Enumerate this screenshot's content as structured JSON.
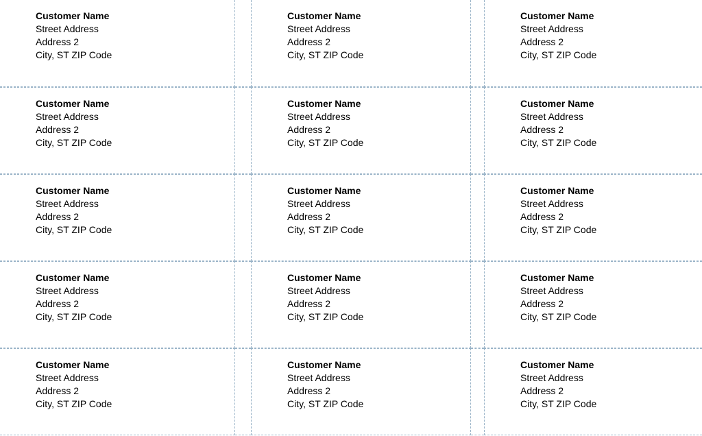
{
  "labels": [
    [
      {
        "name": "Customer Name",
        "street": "Street Address",
        "addr2": "Address 2",
        "csz": "City, ST  ZIP Code"
      },
      {
        "name": "Customer Name",
        "street": "Street Address",
        "addr2": "Address 2",
        "csz": "City, ST  ZIP Code"
      },
      {
        "name": "Customer Name",
        "street": "Street Address",
        "addr2": "Address 2",
        "csz": "City, ST  ZIP Code"
      }
    ],
    [
      {
        "name": "Customer Name",
        "street": "Street Address",
        "addr2": "Address 2",
        "csz": "City, ST  ZIP Code"
      },
      {
        "name": "Customer Name",
        "street": "Street Address",
        "addr2": "Address 2",
        "csz": "City, ST  ZIP Code"
      },
      {
        "name": "Customer Name",
        "street": "Street Address",
        "addr2": "Address 2",
        "csz": "City, ST  ZIP Code"
      }
    ],
    [
      {
        "name": "Customer Name",
        "street": "Street Address",
        "addr2": "Address 2",
        "csz": "City, ST  ZIP Code"
      },
      {
        "name": "Customer Name",
        "street": "Street Address",
        "addr2": "Address 2",
        "csz": "City, ST  ZIP Code"
      },
      {
        "name": "Customer Name",
        "street": "Street Address",
        "addr2": "Address 2",
        "csz": "City, ST  ZIP Code"
      }
    ],
    [
      {
        "name": "Customer Name",
        "street": "Street Address",
        "addr2": "Address 2",
        "csz": "City, ST  ZIP Code"
      },
      {
        "name": "Customer Name",
        "street": "Street Address",
        "addr2": "Address 2",
        "csz": "City, ST  ZIP Code"
      },
      {
        "name": "Customer Name",
        "street": "Street Address",
        "addr2": "Address 2",
        "csz": "City, ST  ZIP Code"
      }
    ],
    [
      {
        "name": "Customer Name",
        "street": "Street Address",
        "addr2": "Address 2",
        "csz": "City, ST  ZIP Code"
      },
      {
        "name": "Customer Name",
        "street": "Street Address",
        "addr2": "Address 2",
        "csz": "City, ST  ZIP Code"
      },
      {
        "name": "Customer Name",
        "street": "Street Address",
        "addr2": "Address 2",
        "csz": "City, ST  ZIP Code"
      }
    ]
  ]
}
